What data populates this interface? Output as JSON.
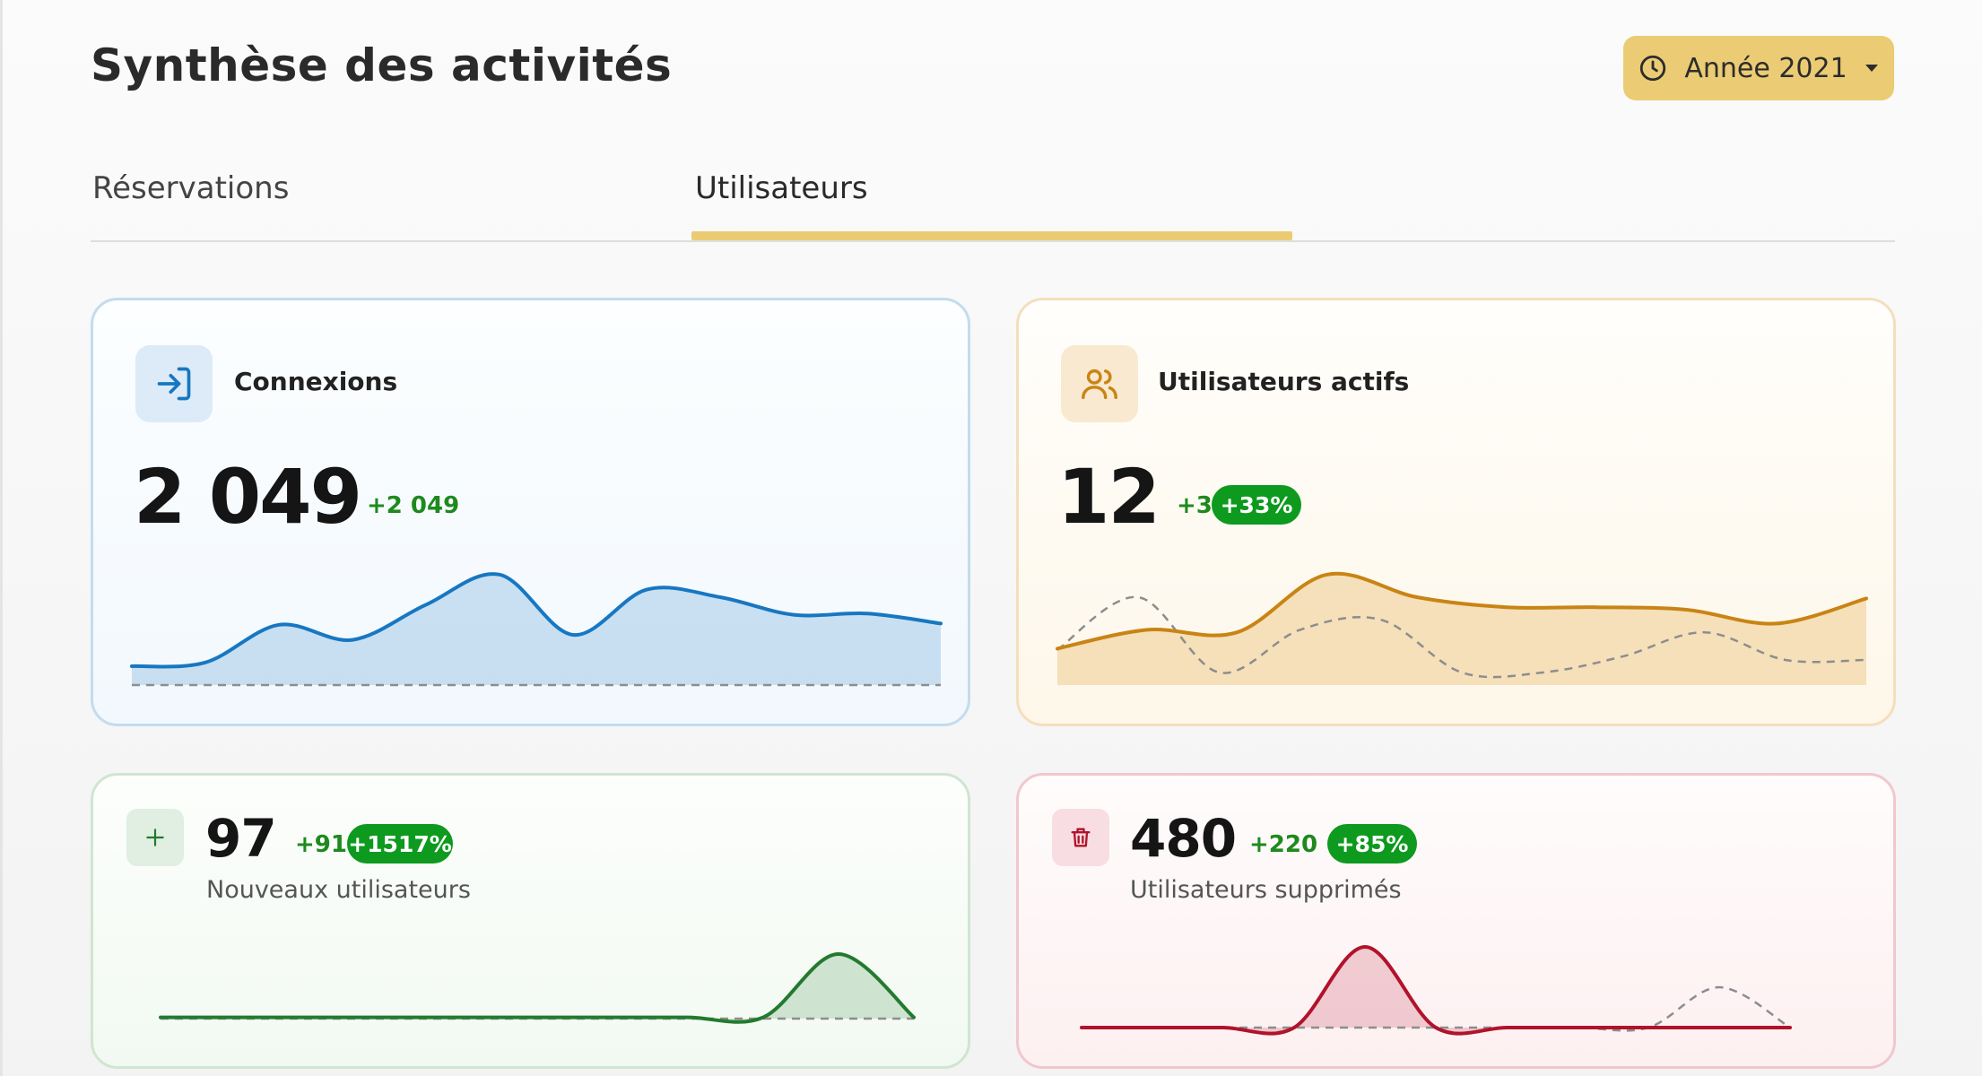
{
  "header": {
    "title": "Synthèse des activités",
    "year_button": {
      "label": "Année 2021",
      "icon": "clock-icon",
      "caret": "caret-down-icon"
    }
  },
  "tabs": [
    {
      "label": "Réservations",
      "active": false
    },
    {
      "label": "Utilisateurs",
      "active": true
    }
  ],
  "colors": {
    "accent": "#ebcc74",
    "blue": "#1777c2",
    "orange": "#c98414",
    "green": "#237a2f",
    "red": "#b0132b",
    "pill_green": "#0d9a1e"
  },
  "cards": {
    "connexions": {
      "title": "Connexions",
      "icon": "login-arrow-icon",
      "value": "2 049",
      "delta": "+2 049"
    },
    "actifs": {
      "title": "Utilisateurs actifs",
      "icon": "users-icon",
      "value": "12",
      "delta": "+3",
      "percent": "+33%"
    },
    "nouveaux": {
      "label": "Nouveaux utilisateurs",
      "icon": "plus-icon",
      "value": "97",
      "delta": "+91",
      "percent": "+1517%"
    },
    "supprimes": {
      "label": "Utilisateurs supprimés",
      "icon": "trash-icon",
      "value": "480",
      "delta": "+220",
      "percent": "+85%"
    }
  },
  "chart_data": [
    {
      "type": "area",
      "name": "connexions",
      "ylim": [
        0,
        100
      ],
      "series": [
        {
          "values": [
            15,
            18,
            48,
            36,
            64,
            88,
            40,
            76,
            70,
            56,
            57,
            49
          ]
        },
        {
          "style": "dashed",
          "values": [
            0,
            0,
            0,
            0,
            0,
            0,
            0,
            0,
            0,
            0,
            0,
            0
          ]
        }
      ]
    },
    {
      "type": "area",
      "name": "utilisateurs-actifs",
      "ylim": [
        0,
        100
      ],
      "series": [
        {
          "values": [
            29,
            44,
            42,
            88,
            70,
            62,
            62,
            60,
            49,
            69
          ]
        },
        {
          "style": "dashed",
          "values": [
            28,
            70,
            10,
            44,
            52,
            10,
            10,
            23,
            42,
            20,
            20
          ]
        }
      ]
    },
    {
      "type": "area",
      "name": "nouveaux-utilisateurs",
      "ylim": [
        0,
        100
      ],
      "series": [
        {
          "values": [
            2,
            2,
            2,
            2,
            2,
            2,
            2,
            2,
            2,
            100,
            2
          ]
        },
        {
          "style": "dashed",
          "values": [
            0,
            0,
            0,
            0,
            0,
            0,
            0,
            0,
            0,
            0,
            0
          ]
        }
      ]
    },
    {
      "type": "area",
      "name": "utilisateurs-supprimes",
      "ylim": [
        0,
        100
      ],
      "series": [
        {
          "values": [
            0,
            0,
            0,
            0,
            100,
            0,
            0,
            0,
            0,
            0,
            0
          ]
        },
        {
          "style": "dashed",
          "values": [
            0,
            0,
            0,
            0,
            0,
            0,
            0,
            0,
            0,
            50,
            0
          ]
        }
      ]
    }
  ]
}
